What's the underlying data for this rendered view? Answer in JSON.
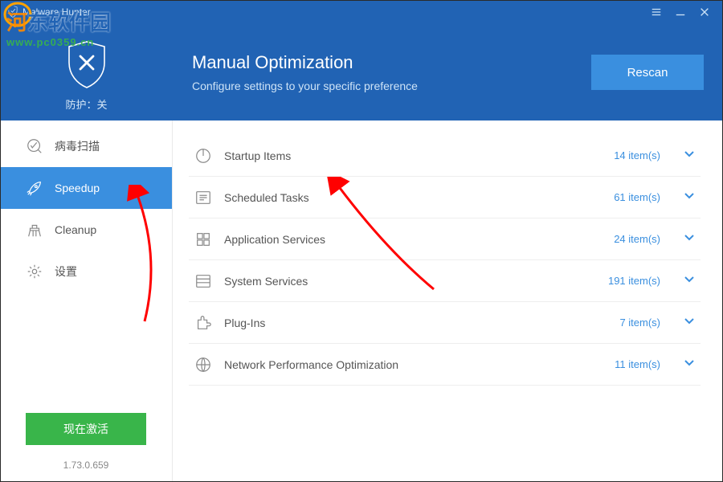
{
  "titlebar": {
    "app_name": "Malware Hunter"
  },
  "header": {
    "protection_status": "防护：关",
    "title": "Manual Optimization",
    "subtitle": "Configure settings to your specific preference",
    "rescan_label": "Rescan"
  },
  "sidebar": {
    "items": [
      {
        "icon": "scan-icon",
        "label": "病毒扫描",
        "active": false
      },
      {
        "icon": "rocket-icon",
        "label": "Speedup",
        "active": true
      },
      {
        "icon": "broom-icon",
        "label": "Cleanup",
        "active": false
      },
      {
        "icon": "gear-icon",
        "label": "设置",
        "active": false
      }
    ],
    "activate_label": "现在激活",
    "version": "1.73.0.659"
  },
  "main": {
    "rows": [
      {
        "icon": "power-icon",
        "label": "Startup Items",
        "count": "14 item(s)"
      },
      {
        "icon": "list-icon",
        "label": "Scheduled Tasks",
        "count": "61 item(s)"
      },
      {
        "icon": "grid-icon",
        "label": "Application Services",
        "count": "24 item(s)"
      },
      {
        "icon": "lines-icon",
        "label": "System Services",
        "count": "191 item(s)"
      },
      {
        "icon": "puzzle-icon",
        "label": "Plug-Ins",
        "count": "7 item(s)"
      },
      {
        "icon": "globe-icon",
        "label": "Network Performance Optimization",
        "count": "11 item(s)"
      }
    ]
  },
  "watermark": {
    "line1a": "河",
    "line1b": "东软件园",
    "line2": "www.pc0359.cn"
  },
  "colors": {
    "primary": "#2163b4",
    "accent": "#3a8fdf",
    "green": "#39b54a"
  }
}
